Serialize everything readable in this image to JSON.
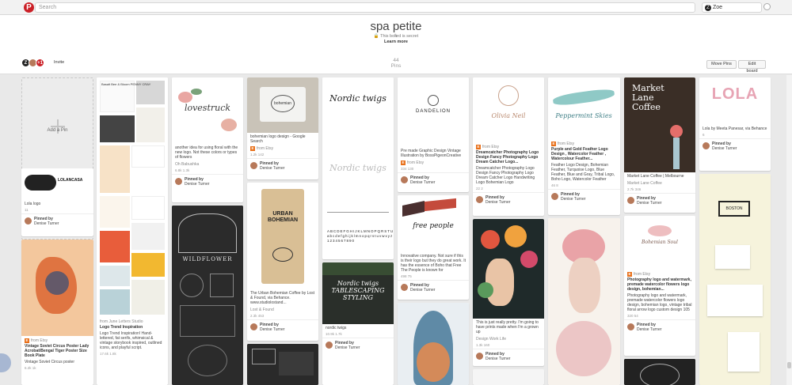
{
  "app": {
    "search_placeholder": "Search",
    "user_name": "Zoe",
    "logo_letter": "P",
    "user_initial": "Z"
  },
  "board": {
    "title": "spa petite",
    "secret_text": "This board is secret",
    "learn_more": "Learn more",
    "pin_count": "44",
    "pins_label": "Pins",
    "invite_label": "Invite",
    "collab_badge": "+1",
    "move_pins_label": "Move Pins",
    "edit_board_label": "Edit board"
  },
  "add_pin_label": "Add a Pin",
  "pins": [
    {
      "col": 1,
      "desc": "Lola logo",
      "src": "",
      "title": "",
      "stat": "11",
      "pinned_by": "Pinned by",
      "pinner": "Denise Turner",
      "img_text": "LOLANCASA"
    },
    {
      "col": 1,
      "desc": "",
      "src": "from Etsy",
      "title": "Vintage Soviet Circus Poster Lady Acrobat/Bengal Tiger Poster Size Book Plate",
      "stat": "6.2k  1k",
      "extra": "Vintage Soviet Circus poster",
      "pinned_by": "Pinned by",
      "pinner": "Denise Turner",
      "img_text": ""
    },
    {
      "col": 2,
      "desc": "",
      "src": "from June Letters Studio",
      "title": "Logo Trend Inspiration",
      "stat": "17.6k  1.8k",
      "extra": "Logo Trend Inspiration! Hand-lettered, fat serifs, whimsical & vintage storybook inspired, outlined icons, and playful script.",
      "pinned_by": "",
      "pinner": "",
      "img_text": "Basalt  Bee & Bloom  PENNY CRAY  MANHATTAN  LA JOIE  Bartolo"
    },
    {
      "col": 3,
      "desc": "another idea for using floral with the new logo. Not these colors or types of flowers",
      "src": "Oh Babushka",
      "title": "",
      "stat": "6.8k  1.3k",
      "pinned_by": "Pinned by",
      "pinner": "Denise Turner",
      "img_text": "lovestruck"
    },
    {
      "col": 3,
      "desc": "",
      "src": "",
      "title": "",
      "stat": "",
      "pinned_by": "",
      "pinner": "",
      "img_text": "WILDFLOWER"
    },
    {
      "col": 4,
      "desc": "bohemian logo design - Google Search",
      "src": "from Etsy",
      "title": "",
      "stat": "1.2k  142",
      "pinned_by": "Pinned by",
      "pinner": "Denise Turner",
      "img_text": "bohemian"
    },
    {
      "col": 4,
      "desc": "The Urban Bohemian Coffee by Lost & Found, via Behance. www.studiolostand...",
      "src": "Lost & Found",
      "title": "",
      "stat": "2.3k  453",
      "pinned_by": "Pinned by",
      "pinner": "Denise Turner",
      "img_text": "URBAN BOHEMIAN"
    },
    {
      "col": 4,
      "desc": "",
      "src": "",
      "title": "",
      "stat": "",
      "pinned_by": "",
      "pinner": "",
      "img_text": "TYPOGRAPHIC"
    },
    {
      "col": 5,
      "desc": "",
      "src": "",
      "title": "",
      "stat": "",
      "pinned_by": "",
      "pinner": "",
      "img_text": "Nordic twigs"
    },
    {
      "col": 5,
      "desc": "nordic twigs",
      "src": "",
      "title": "",
      "stat": "10.9k  1.7k",
      "pinned_by": "Pinned by",
      "pinner": "Denise Turner",
      "img_text": "Nordic twigs  TABLESCAPING STYLING"
    },
    {
      "col": 6,
      "desc": "Pre made Graphic Design Vintage Illustration by BossPigeonCreative",
      "src": "from Etsy",
      "title": "",
      "stat": "334  130",
      "pinned_by": "Pinned by",
      "pinner": "Denise Turner",
      "img_text": "DANDELION"
    },
    {
      "col": 6,
      "desc": "Innovative company. Not sure if this is their logo but they do great work. It has the essence of Boho that Free The People is known for",
      "src": "",
      "title": "",
      "stat": "498  75",
      "pinned_by": "Pinned by",
      "pinner": "Denise Turner",
      "img_text": "free people"
    },
    {
      "col": 7,
      "desc": "Dreamcatcher Photography Logo Design Fancy Photography Logo Dream Catcher Logo Handwriting Logo Bohemian Logo",
      "src": "from Etsy",
      "title": "Dreamcatcher Photography Logo Design Fancy Photography Logo Dream Catcher Logo...",
      "stat": "22  2",
      "pinned_by": "Pinned by",
      "pinner": "Denise Turner",
      "img_text": "Olivia Neil"
    },
    {
      "col": 7,
      "desc": "This is just really pretty. I'm going to have prints made when I'm a grown up",
      "src": "Design Work Life",
      "title": "",
      "stat": "1.3k  160",
      "pinned_by": "Pinned by",
      "pinner": "Denise Turner",
      "img_text": ""
    },
    {
      "col": 8,
      "desc": "Feather Logo Design, Bohemian Feather, Turquoise Logo, Blue Feather, Blue and Gray, Tribal Logo, Boho Logo, Watercolor Feather",
      "src": "from Etsy",
      "title": "Purple and Gold Feather Logo Design , Watercolor Feather , Watercolour Feather...",
      "stat": "46  8",
      "pinned_by": "Pinned by",
      "pinner": "Denise Turner",
      "img_text": "Peppermint Skies"
    },
    {
      "col": 9,
      "desc": "Market Lane Coffee | Melbourne",
      "src": "Market Lane Coffee",
      "title": "",
      "stat": "2.7k  346",
      "pinned_by": "Pinned by",
      "pinner": "Denise Turner",
      "img_text": "Market Lane Coffee"
    },
    {
      "col": 9,
      "desc": "Photography logo and watermark, premade watercolor flowers logo design, bohemian logo, vintage tribal floral arrow logo custom design 105",
      "src": "from Etsy",
      "title": "Photography logo and watermark, premade watercolor flowers logo design, bohemian...",
      "stat": "320  54",
      "pinned_by": "Pinned by",
      "pinner": "Denise Turner",
      "img_text": "Bohemian Soul"
    },
    {
      "col": 10,
      "desc": "Lola by Meeta Panesar, via Behance",
      "src": "",
      "title": "",
      "stat": "6",
      "pinned_by": "Pinned by",
      "pinner": "Denise Turner",
      "img_text": "LOLA"
    },
    {
      "col": 10,
      "desc": "",
      "src": "",
      "title": "",
      "stat": "",
      "pinned_by": "",
      "pinner": "",
      "img_text": "BOSTON"
    }
  ],
  "colors": {
    "accent_red": "#cb2027",
    "etsy_orange": "#e8701a"
  }
}
